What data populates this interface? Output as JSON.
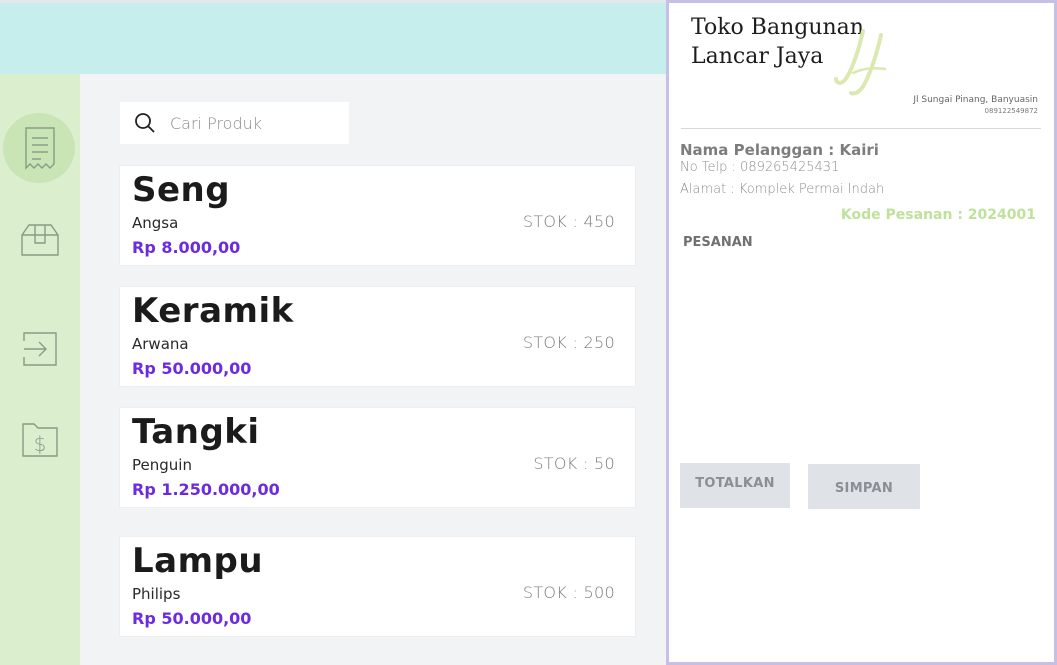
{
  "search": {
    "placeholder": "Cari Produk",
    "value": ""
  },
  "nav": [
    {
      "icon": "receipt-icon",
      "active": true
    },
    {
      "icon": "box-icon",
      "active": false
    },
    {
      "icon": "login-icon",
      "active": false
    },
    {
      "icon": "money-folder-icon",
      "active": false
    }
  ],
  "products": [
    {
      "name": "Seng",
      "brand": "Angsa",
      "price": "Rp 8.000,00",
      "stock": "STOK : 450"
    },
    {
      "name": "Keramik",
      "brand": "Arwana",
      "price": "Rp 50.000,00",
      "stock": "STOK : 250"
    },
    {
      "name": "Tangki",
      "brand": "Penguin",
      "price": "Rp 1.250.000,00",
      "stock": "STOK : 50"
    },
    {
      "name": "Lampu",
      "brand": "Philips",
      "price": "Rp 50.000,00",
      "stock": "STOK : 500"
    }
  ],
  "receipt": {
    "store_line1": "Toko Bangunan",
    "store_line2": "Lancar Jaya",
    "logo_text": "LJ",
    "address": "Jl Sungai Pinang, Banyuasin",
    "phone": "089122549872",
    "customer_name": "Nama Pelanggan : Kairi",
    "customer_phone": "No Telp : 089265425431",
    "customer_address": "Alamat : Komplek Permai Indah",
    "order_code": "Kode Pesanan : 2024001",
    "order_heading": "PESANAN",
    "total_label": "TOTALKAN",
    "save_label": "SIMPAN"
  },
  "colors": {
    "topbar": "#c6eeed",
    "sidebar": "#dbefcf",
    "price": "#6d2be0",
    "order_code": "#bfe29b",
    "receipt_border": "#c7bfe6"
  }
}
